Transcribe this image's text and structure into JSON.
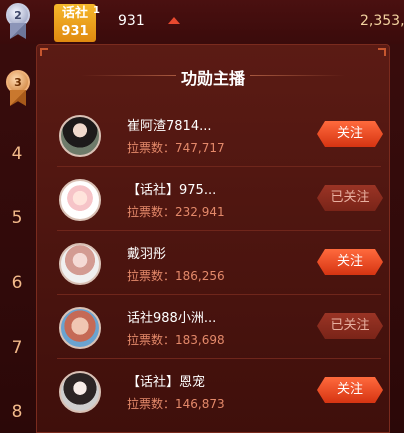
{
  "top_row": {
    "rank_medal_2": "2",
    "tag_badge": {
      "line1": "话社",
      "line2": "931",
      "sup": "1"
    },
    "number": "931",
    "score": "2,353,"
  },
  "rank_medal_3": "3",
  "rank_numbers": [
    "4",
    "5",
    "6",
    "7",
    "8"
  ],
  "popup": {
    "title": "功勋主播",
    "anchors": [
      {
        "name": "崔阿渣7814...",
        "votes": "拉票数：747,717",
        "button": "关注",
        "followed": false
      },
      {
        "name": "【话社】975...",
        "votes": "拉票数：232,941",
        "button": "已关注",
        "followed": true
      },
      {
        "name": "戴羽彤",
        "votes": "拉票数：186,256",
        "button": "关注",
        "followed": false
      },
      {
        "name": "话社988小洲...",
        "votes": "拉票数：183,698",
        "button": "已关注",
        "followed": true
      },
      {
        "name": "【话社】恩宠",
        "votes": "拉票数：146,873",
        "button": "关注",
        "followed": false
      }
    ]
  },
  "colors": {
    "accent": "#e8492f",
    "votes": "#e4896a",
    "gold": "#f6b82b"
  }
}
